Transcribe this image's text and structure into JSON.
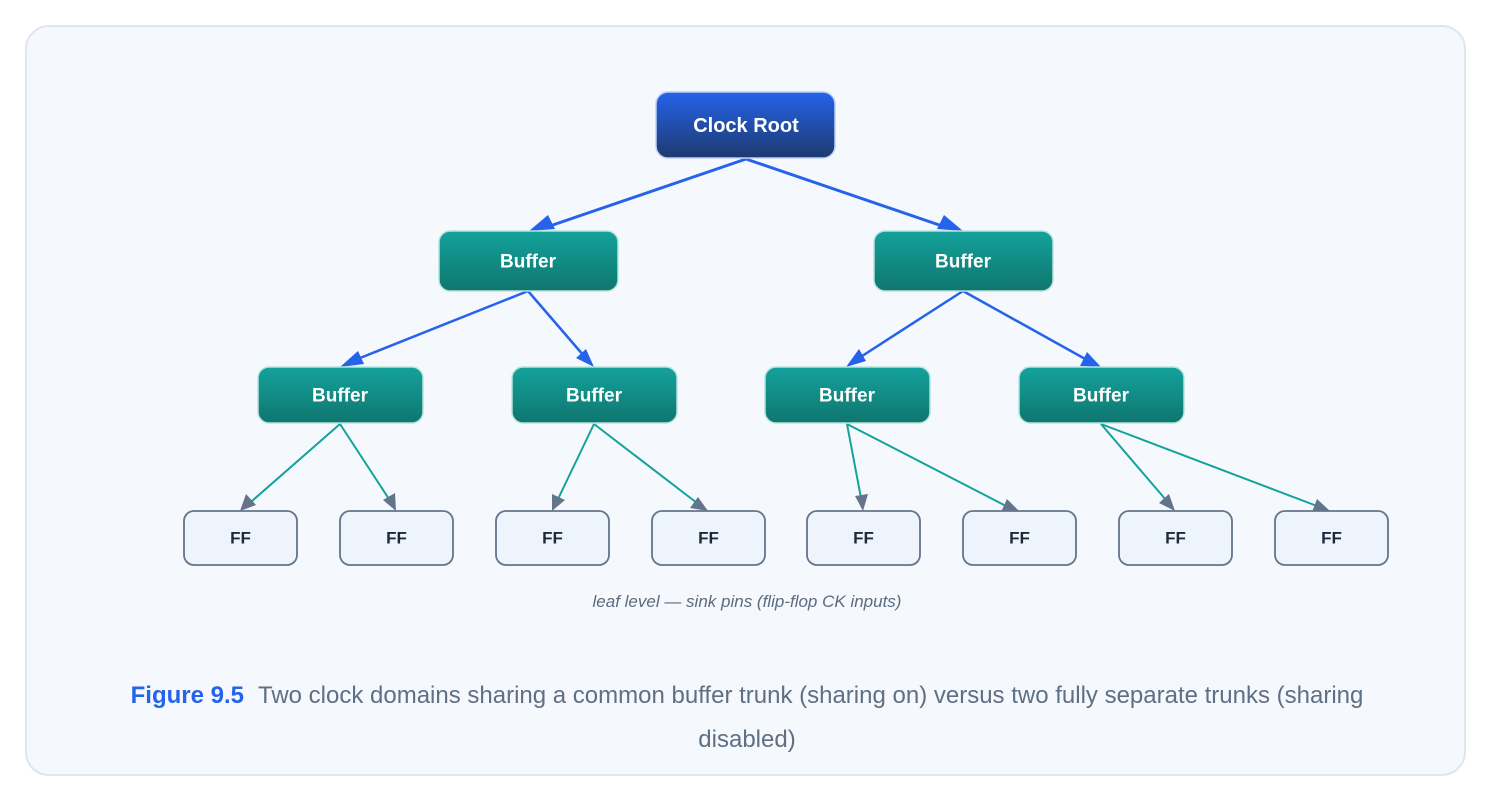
{
  "diagram": {
    "root": {
      "label": "Clock Root"
    },
    "level1": [
      {
        "label": "Buffer"
      },
      {
        "label": "Buffer"
      }
    ],
    "level2": [
      {
        "label": "Buffer"
      },
      {
        "label": "Buffer"
      },
      {
        "label": "Buffer"
      },
      {
        "label": "Buffer"
      }
    ],
    "leaves": [
      {
        "label": "FF"
      },
      {
        "label": "FF"
      },
      {
        "label": "FF"
      },
      {
        "label": "FF"
      },
      {
        "label": "FF"
      },
      {
        "label": "FF"
      },
      {
        "label": "FF"
      },
      {
        "label": "FF"
      }
    ],
    "leaf_note": "leaf level — sink pins (flip-flop CK inputs)"
  },
  "caption": {
    "figure_label": "Figure 9.5",
    "text": "Two clock domains sharing a common buffer trunk (sharing on) versus two fully separate trunks (sharing disabled)"
  },
  "colors": {
    "root_top": "#2563eb",
    "root_bottom": "#1e3a6e",
    "buffer_top": "#14a29c",
    "buffer_bottom": "#0f766e",
    "trunk_edge": "#2563eb",
    "leaf_edge": "#14a29c",
    "leaf_fill": "#eef4fb",
    "leaf_stroke": "#64748b",
    "leaf_arrow": "#64748b"
  }
}
